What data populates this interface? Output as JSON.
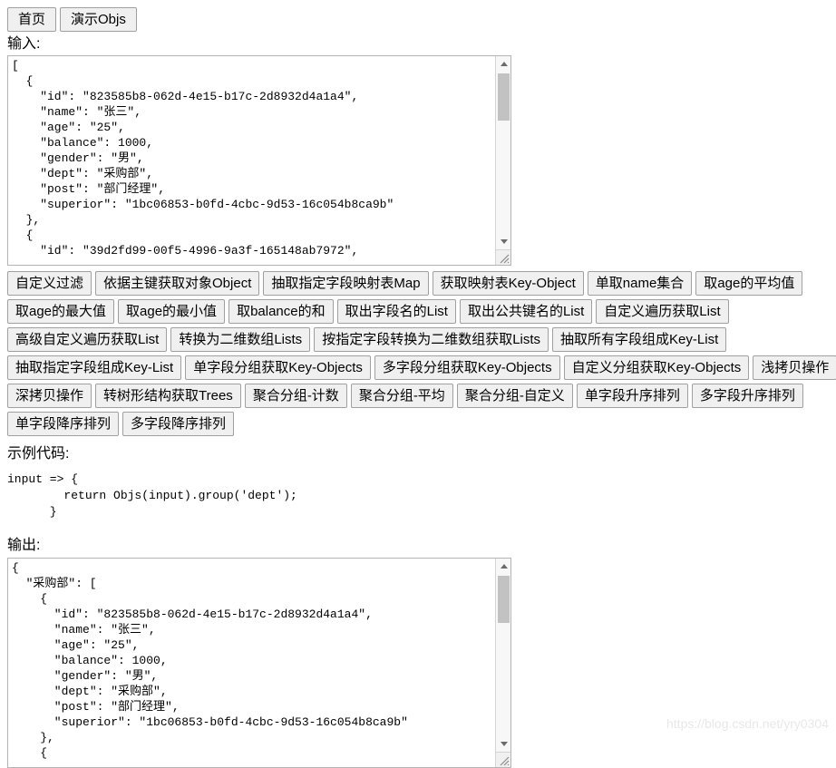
{
  "nav": {
    "items": [
      {
        "label": "首页",
        "name": "nav-home"
      },
      {
        "label": "演示Objs",
        "name": "nav-demo-objs"
      }
    ]
  },
  "input_section": {
    "label": "输入:",
    "value": "[\n  {\n    \"id\": \"823585b8-062d-4e15-b17c-2d8932d4a1a4\",\n    \"name\": \"张三\",\n    \"age\": \"25\",\n    \"balance\": 1000,\n    \"gender\": \"男\",\n    \"dept\": \"采购部\",\n    \"post\": \"部门经理\",\n    \"superior\": \"1bc06853-b0fd-4cbc-9d53-16c054b8ca9b\"\n  },\n  {\n    \"id\": \"39d2fd99-00f5-4996-9a3f-165148ab7972\","
  },
  "buttons": {
    "rows": [
      [
        "自定义过滤",
        "依据主键获取对象Object",
        "抽取指定字段映射表Map",
        "获取映射表Key-Object",
        "单取name集合",
        "取age的平均值"
      ],
      [
        "取age的最大值",
        "取age的最小值",
        "取balance的和",
        "取出字段名的List",
        "取出公共键名的List",
        "自定义遍历获取List"
      ],
      [
        "高级自定义遍历获取List",
        "转换为二维数组Lists",
        "按指定字段转换为二维数组获取Lists",
        "抽取所有字段组成Key-List"
      ],
      [
        "抽取指定字段组成Key-List",
        "单字段分组获取Key-Objects",
        "多字段分组获取Key-Objects",
        "自定义分组获取Key-Objects",
        "浅拷贝操作"
      ],
      [
        "深拷贝操作",
        "转树形结构获取Trees",
        "聚合分组-计数",
        "聚合分组-平均",
        "聚合分组-自定义",
        "单字段升序排列",
        "多字段升序排列"
      ],
      [
        "单字段降序排列",
        "多字段降序排列"
      ]
    ]
  },
  "code_section": {
    "label": "示例代码:",
    "code": "input => {\n        return Objs(input).group('dept');\n      }"
  },
  "output_section": {
    "label": "输出:",
    "value": "{\n  \"采购部\": [\n    {\n      \"id\": \"823585b8-062d-4e15-b17c-2d8932d4a1a4\",\n      \"name\": \"张三\",\n      \"age\": \"25\",\n      \"balance\": 1000,\n      \"gender\": \"男\",\n      \"dept\": \"采购部\",\n      \"post\": \"部门经理\",\n      \"superior\": \"1bc06853-b0fd-4cbc-9d53-16c054b8ca9b\"\n    },\n    {"
  },
  "watermark": {
    "text": "https://blog.csdn.net/yry0304"
  },
  "colors": {
    "button_face": "#f0f0f0",
    "button_border": "#a0a0a0",
    "textarea_border": "#b4b4b4",
    "scrollbar_thumb": "#c2c2c2",
    "watermark": "#e8e8e8"
  }
}
